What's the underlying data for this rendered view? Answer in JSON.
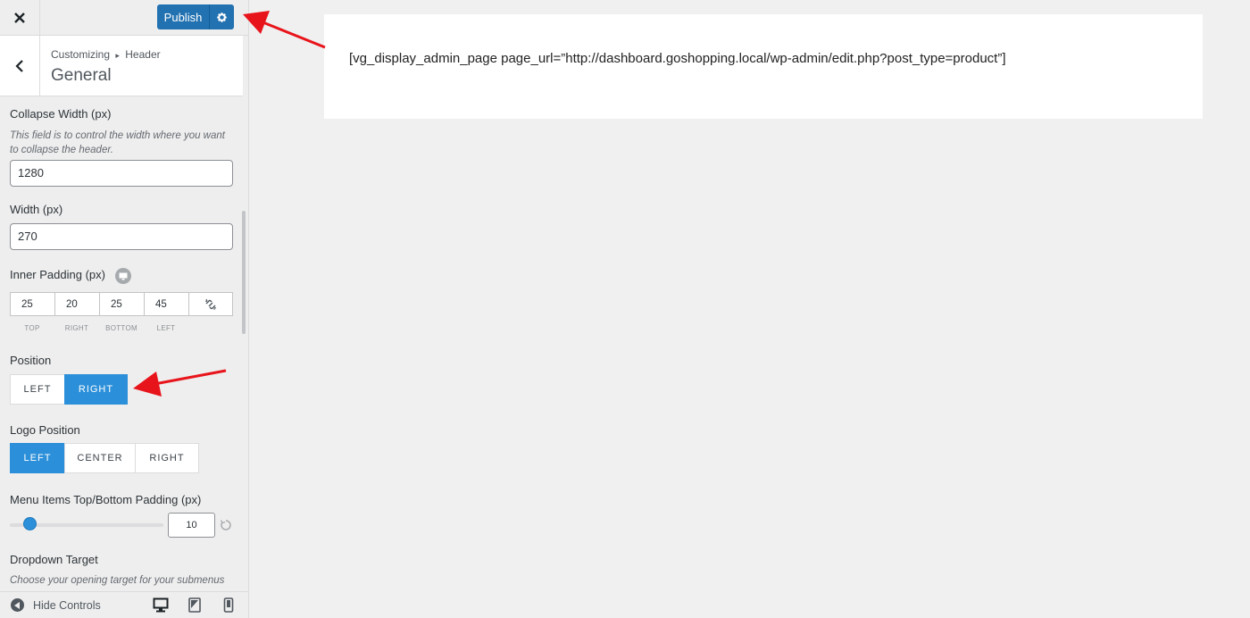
{
  "topbar": {
    "close_icon": "close-icon",
    "publish_label": "Publish",
    "settings_icon": "gear-icon"
  },
  "section": {
    "breadcrumb_root": "Customizing",
    "breadcrumb_separator": "▸",
    "breadcrumb_parent": "Header",
    "title": "General",
    "back_icon": "chevron-left-icon"
  },
  "controls": {
    "collapse_width": {
      "label": "Collapse Width (px)",
      "description": "This field is to control the width where you want to collapse the header.",
      "value": "1280"
    },
    "width": {
      "label": "Width (px)",
      "value": "270"
    },
    "inner_padding": {
      "label": "Inner Padding (px)",
      "top": "25",
      "right": "20",
      "bottom": "25",
      "left": "45",
      "top_label": "TOP",
      "right_label": "RIGHT",
      "bottom_label": "BOTTOM",
      "left_label": "LEFT",
      "device_icon": "desktop-icon",
      "link_icon": "unlink-icon"
    },
    "position": {
      "label": "Position",
      "options": [
        "LEFT",
        "RIGHT"
      ],
      "selected": "RIGHT"
    },
    "logo_position": {
      "label": "Logo Position",
      "options": [
        "LEFT",
        "CENTER",
        "RIGHT"
      ],
      "selected": "LEFT"
    },
    "menu_padding": {
      "label": "Menu Items Top/Bottom Padding (px)",
      "value": "10",
      "reset_icon": "reset-icon"
    },
    "dropdown_target": {
      "label": "Dropdown Target",
      "description": "Choose your opening target for your submenus"
    }
  },
  "footer": {
    "hide_controls_label": "Hide Controls",
    "devices": [
      "desktop-icon",
      "tablet-icon",
      "mobile-icon"
    ]
  },
  "preview": {
    "shortcode": "[vg_display_admin_page page_url=”http://dashboard.goshopping.local/wp-admin/edit.php?post_type=product”]"
  },
  "colors": {
    "primary": "#2271b1",
    "active_segment": "#2b8fd9",
    "annotation_arrow": "#e8141b"
  }
}
